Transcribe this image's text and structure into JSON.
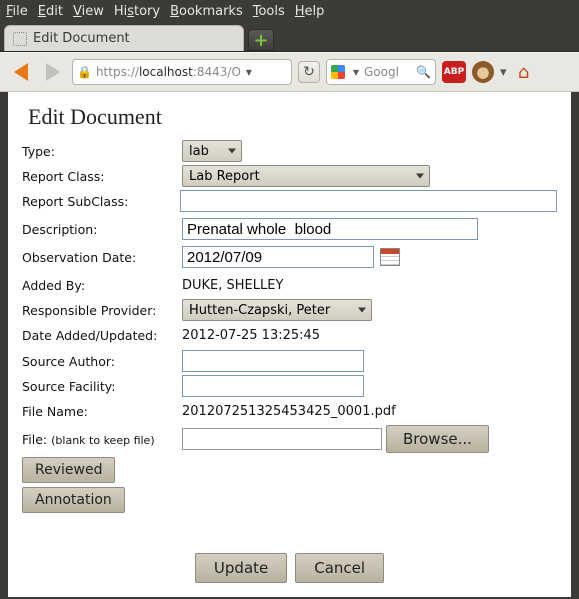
{
  "menubar": {
    "file": "File",
    "edit": "Edit",
    "view": "View",
    "history": "History",
    "bookmarks": "Bookmarks",
    "tools": "Tools",
    "help": "Help"
  },
  "tab": {
    "title": "Edit Document"
  },
  "url": {
    "proto": "https://",
    "host": "localhost",
    "rest": ":8443/O"
  },
  "search": {
    "placeholder": "Googl"
  },
  "abp_label": "ABP",
  "page": {
    "heading": "Edit Document",
    "labels": {
      "type": "Type:",
      "report_class": "Report Class:",
      "report_subclass": "Report SubClass:",
      "description": "Description:",
      "obs_date": "Observation Date:",
      "added_by": "Added By:",
      "resp_provider": "Responsible Provider:",
      "date_added": "Date Added/Updated:",
      "src_author": "Source Author:",
      "src_facility": "Source Facility:",
      "file_name": "File Name:",
      "file": "File:",
      "file_hint": "(blank to keep file)"
    },
    "values": {
      "type": "lab",
      "report_class": "Lab Report",
      "report_subclass": "",
      "description": "Prenatal whole  blood",
      "obs_date": "2012/07/09",
      "added_by": "DUKE, SHELLEY",
      "resp_provider": "Hutten-Czapski, Peter",
      "date_added": "2012-07-25 13:25:45",
      "src_author": "",
      "src_facility": "",
      "file_name": "201207251325453425_0001.pdf",
      "file_path": ""
    },
    "buttons": {
      "browse": "Browse...",
      "reviewed": "Reviewed",
      "annotation": "Annotation",
      "update": "Update",
      "cancel": "Cancel"
    }
  }
}
